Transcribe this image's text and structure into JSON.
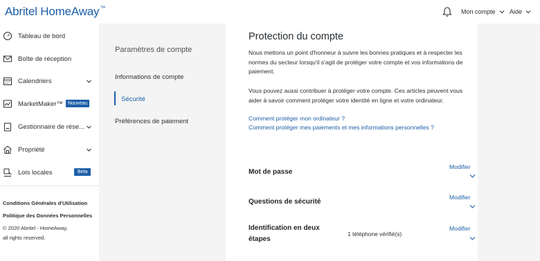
{
  "header": {
    "logo": "Abritel HomeAway",
    "trademark": "™",
    "account_label": "Mon compte",
    "help_label": "Aide"
  },
  "sidebar": {
    "items": [
      {
        "label": "Tableau de bord",
        "icon": "dashboard-gauge-icon"
      },
      {
        "label": "Boîte de réception",
        "icon": "envelope-icon"
      },
      {
        "label": "Calendriers",
        "icon": "calendar-icon"
      },
      {
        "label": "MarketMaker™",
        "icon": "chart-line-icon",
        "badge": "Nouveau"
      },
      {
        "label": "Gestionnaire de rése...",
        "icon": "clipboard-icon"
      },
      {
        "label": "Propriété",
        "icon": "house-icon"
      },
      {
        "label": "Lois locales",
        "icon": "gavel-icon",
        "badge": "Beta"
      }
    ],
    "footer": {
      "terms": "Conditions Générales d'Utilisation",
      "privacy": "Politique des Données Personnelles",
      "copyright": "© 2020 Abritel - HomeAway,",
      "rights": "all rights reserved."
    }
  },
  "settings": {
    "title": "Paramètres de compte",
    "items": [
      "Informations de compte",
      "Sécurité",
      "Préférences de paiement"
    ],
    "active": "Sécurité"
  },
  "main": {
    "title": "Protection du compte",
    "para1": "Nous mettons un point d'honneur à suivre les bonnes pratiques et à respecter les normes du secteur lorsqu'il s'agit de protéger votre compte et vos informations de paiement.",
    "para2": "Vous pouvez aussi contribuer à protéger votre compte. Ces articles peuvent vous aider à savoir comment protéger votre identité en ligne et votre ordinateur.",
    "link1": "Comment protéger mon ordinateur ?",
    "link2": "Comment protéger mes paiements et mes informations personnelles ?",
    "rows": [
      {
        "label": "Mot de passe",
        "value": "",
        "action": "Modifier"
      },
      {
        "label": "Questions de sécurité",
        "value": "",
        "action": "Modifier"
      },
      {
        "label": "Identification en deux étapes",
        "value": "1 téléphone vérifié(s)",
        "action": "Modifier"
      }
    ]
  },
  "colors": {
    "brand": "#1c5fa8",
    "background": "#f4f4f4",
    "text": "#2a2f33"
  }
}
